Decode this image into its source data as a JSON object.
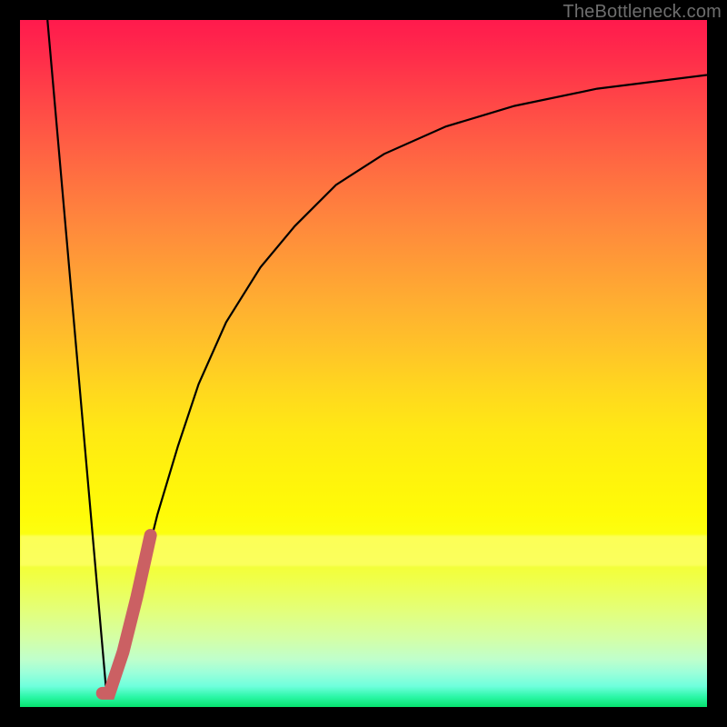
{
  "watermark": "TheBottleneck.com",
  "chart_data": {
    "type": "line",
    "title": "",
    "xlabel": "",
    "ylabel": "",
    "xlim": [
      0,
      100
    ],
    "ylim": [
      0,
      100
    ],
    "grid": false,
    "series": [
      {
        "name": "left-edge",
        "x": [
          4,
          12.5
        ],
        "y": [
          100,
          3
        ]
      },
      {
        "name": "saturation-curve",
        "x": [
          12.5,
          14,
          16,
          18,
          20,
          23,
          26,
          30,
          35,
          40,
          46,
          53,
          62,
          72,
          84,
          100
        ],
        "y": [
          3,
          6,
          12,
          20,
          28,
          38,
          47,
          56,
          64,
          70,
          76,
          80.5,
          84.5,
          87.5,
          90,
          92
        ]
      },
      {
        "name": "highlight-marker",
        "x": [
          12,
          13,
          15,
          17,
          19
        ],
        "y": [
          2,
          2,
          8,
          16,
          25
        ]
      }
    ],
    "background_gradient": {
      "direction": "vertical",
      "stops": [
        {
          "pos": 0.0,
          "color": "#ff1a4d"
        },
        {
          "pos": 0.5,
          "color": "#ffd81e"
        },
        {
          "pos": 0.75,
          "color": "#fcff10"
        },
        {
          "pos": 0.95,
          "color": "#9cffda"
        },
        {
          "pos": 1.0,
          "color": "#06e26e"
        }
      ]
    },
    "annotations": []
  },
  "colors": {
    "frame": "#000000",
    "curve": "#000000",
    "marker": "#cb6063",
    "watermark": "#6e6e6e"
  }
}
